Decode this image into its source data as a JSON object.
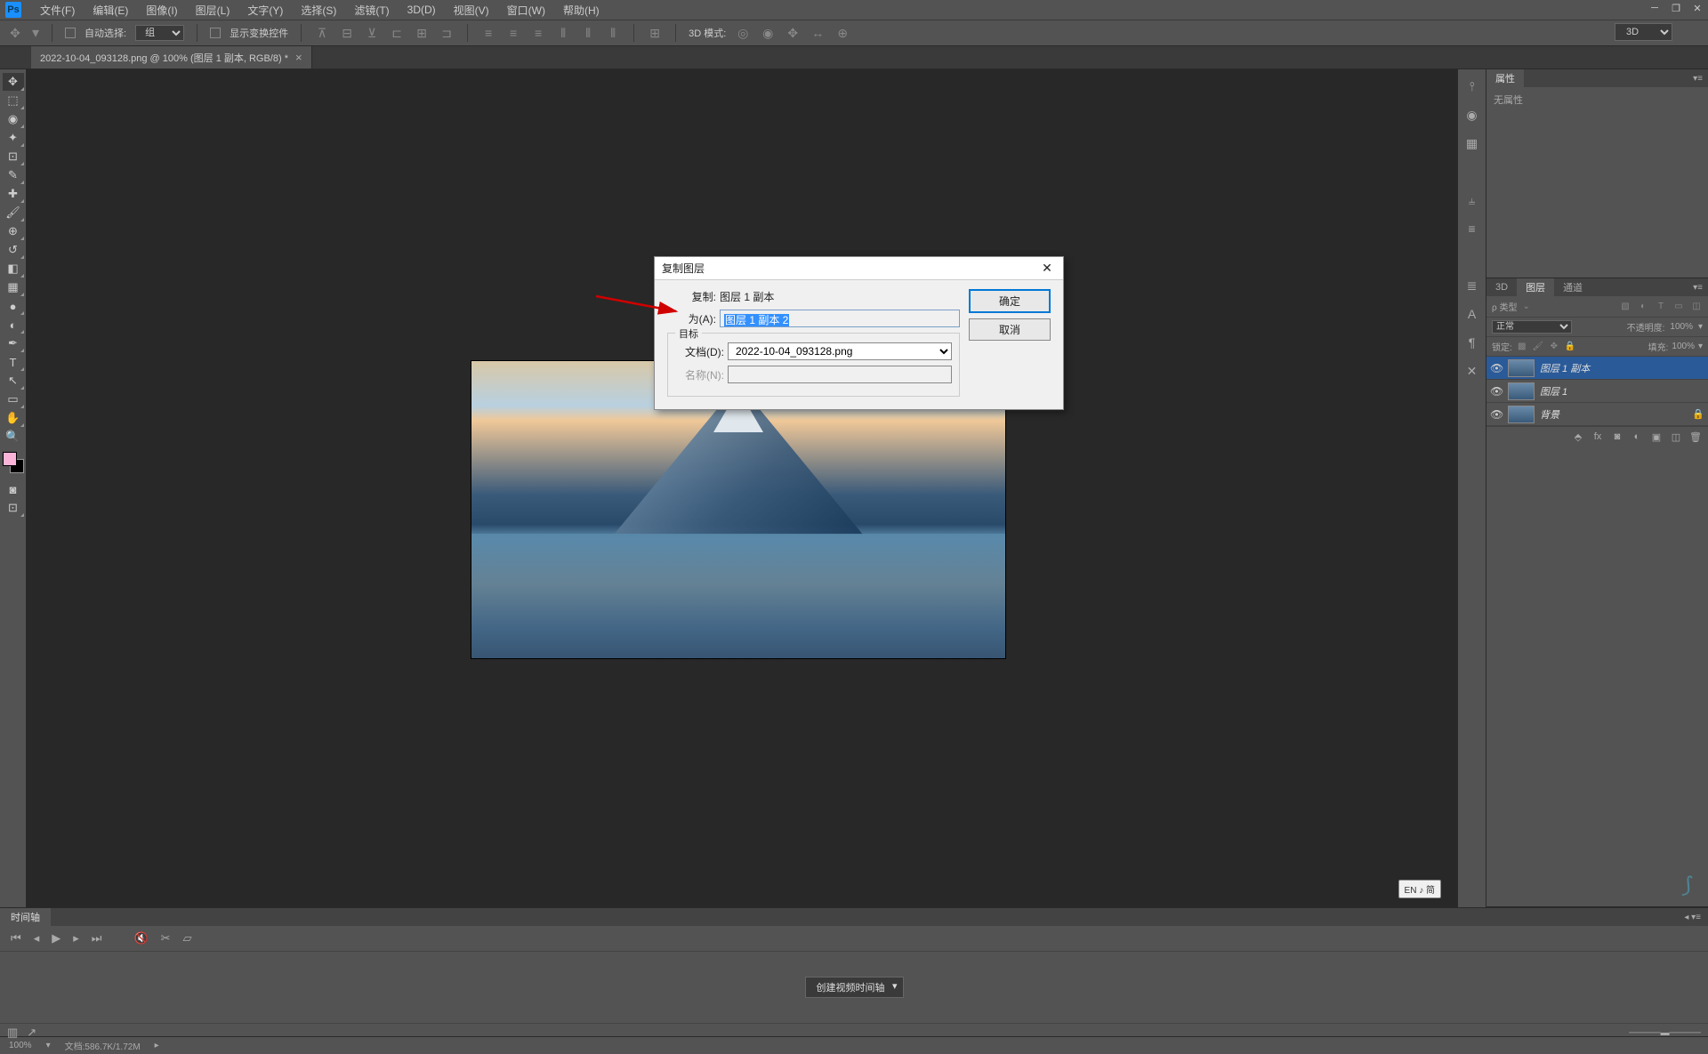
{
  "menu": {
    "file": "文件(F)",
    "edit": "编辑(E)",
    "image": "图像(I)",
    "layer": "图层(L)",
    "type": "文字(Y)",
    "select": "选择(S)",
    "filter": "滤镜(T)",
    "d3": "3D(D)",
    "view": "视图(V)",
    "window": "窗口(W)",
    "help": "帮助(H)"
  },
  "options": {
    "autoSelect": "自动选择:",
    "group": "组",
    "showTransform": "显示变换控件",
    "mode3d": "3D 模式:",
    "d3label": "3D"
  },
  "doc_tab": "2022-10-04_093128.png @ 100% (图层 1 副本, RGB/8) *",
  "dialog": {
    "title": "复制图层",
    "copyLabel": "复制:",
    "copyValue": "图层 1 副本",
    "asLabel": "为(A):",
    "asValueSelected": "图层 1 副本 2",
    "targetGroup": "目标",
    "docLabel": "文档(D):",
    "docValue": "2022-10-04_093128.png",
    "nameLabel": "名称(N):",
    "ok": "确定",
    "cancel": "取消"
  },
  "panels": {
    "properties": "属性",
    "noProps": "无属性",
    "d3": "3D",
    "layers": "图层",
    "channels": "通道",
    "kind": "ρ 类型",
    "normal": "正常",
    "opacity": "不透明度:",
    "opVal": "100%",
    "lock": "锁定:",
    "fill": "填充:",
    "fillVal": "100%",
    "layerList": [
      {
        "name": "图层 1 副本",
        "selected": true
      },
      {
        "name": "图层 1",
        "selected": false
      },
      {
        "name": "背景",
        "selected": false,
        "locked": true
      }
    ]
  },
  "timeline": {
    "tab": "时间轴",
    "create": "创建视频时间轴"
  },
  "status": {
    "zoom": "100%",
    "docSize": "文档:586.7K/1.72M"
  },
  "ime": "EN ♪ 简"
}
